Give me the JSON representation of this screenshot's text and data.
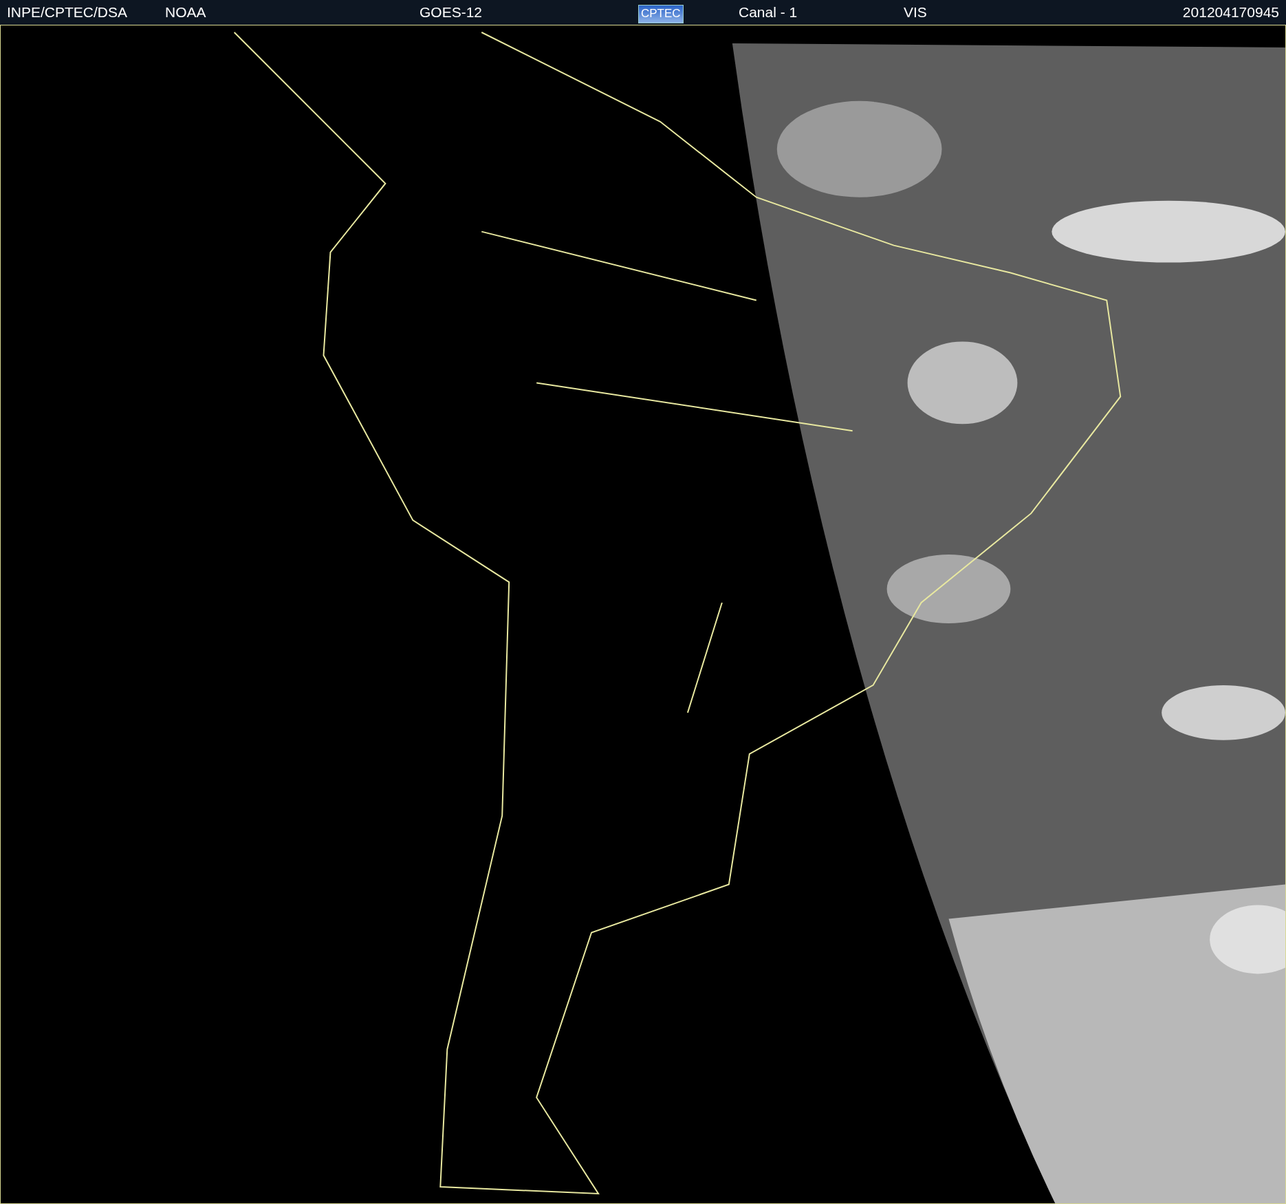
{
  "header": {
    "items": [
      {
        "kind": "text",
        "text": "INPE/CPTEC/DSA"
      },
      {
        "kind": "text",
        "text": "NOAA"
      },
      {
        "kind": "text",
        "text": "GOES-12"
      },
      {
        "kind": "logo",
        "text": "CPTEC"
      },
      {
        "kind": "text",
        "text": "Canal - 1"
      },
      {
        "kind": "text",
        "text": "VIS"
      },
      {
        "kind": "text",
        "text": "201204170945"
      }
    ]
  }
}
